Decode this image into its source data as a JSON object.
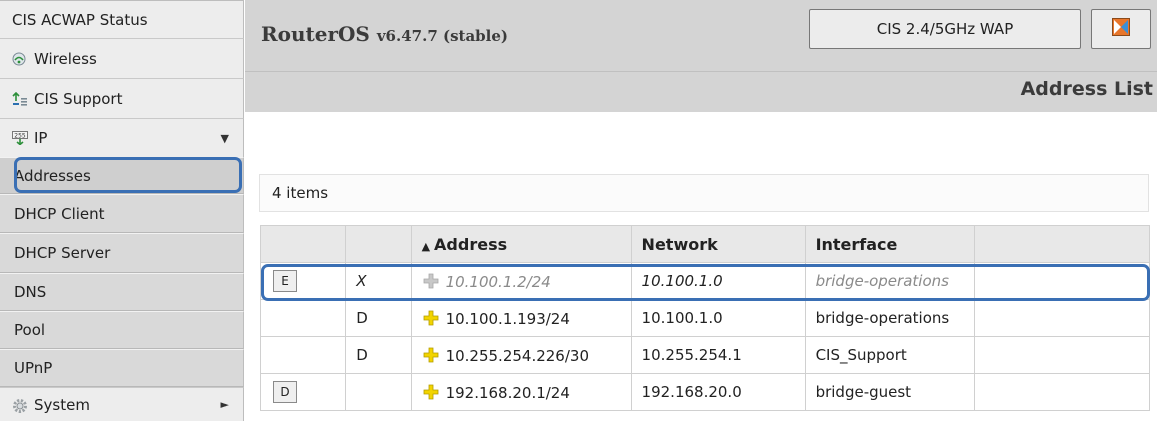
{
  "sidebar": {
    "items": [
      {
        "label": "CIS ACWAP Status",
        "icon": ""
      },
      {
        "label": "Wireless",
        "icon": "wireless-icon"
      },
      {
        "label": "CIS Support",
        "icon": "support-icon"
      },
      {
        "label": "IP",
        "icon": "ip-icon",
        "arrow": "▼"
      },
      {
        "label": "Addresses",
        "selected": true
      },
      {
        "label": "DHCP Client"
      },
      {
        "label": "DHCP Server"
      },
      {
        "label": "DNS"
      },
      {
        "label": "Pool"
      },
      {
        "label": "UPnP"
      },
      {
        "label": "System",
        "icon": "gear-icon",
        "arrow": "►"
      }
    ]
  },
  "header": {
    "title": "RouterOS",
    "version": "v6.47.7 (stable)",
    "device_button": "CIS 2.4/5GHz WAP",
    "skin_icon": "skin-designer-icon",
    "page_heading": "Address List"
  },
  "list": {
    "count_label": "4 items",
    "columns": [
      "",
      "",
      "Address",
      "Network",
      "Interface",
      ""
    ],
    "sort_indicator": "▲",
    "rows": [
      {
        "button": "E",
        "flag": "X",
        "address": "10.100.1.2/24",
        "network": "10.100.1.0",
        "interface": "bridge-operations",
        "disabled": true
      },
      {
        "button": "",
        "flag": "D",
        "address": "10.100.1.193/24",
        "network": "10.100.1.0",
        "interface": "bridge-operations",
        "disabled": false
      },
      {
        "button": "",
        "flag": "D",
        "address": "10.255.254.226/30",
        "network": "10.255.254.1",
        "interface": "CIS_Support",
        "disabled": false
      },
      {
        "button": "D",
        "flag": "",
        "address": "192.168.20.1/24",
        "network": "192.168.20.0",
        "interface": "bridge-guest",
        "disabled": false
      }
    ]
  },
  "colors": {
    "highlight": "#3a6fb4",
    "header_bg": "#d4d4d4",
    "sidebar_bg": "#ededed",
    "submenu_bg": "#d9d9d9",
    "plus_icon": "#f2d400"
  }
}
